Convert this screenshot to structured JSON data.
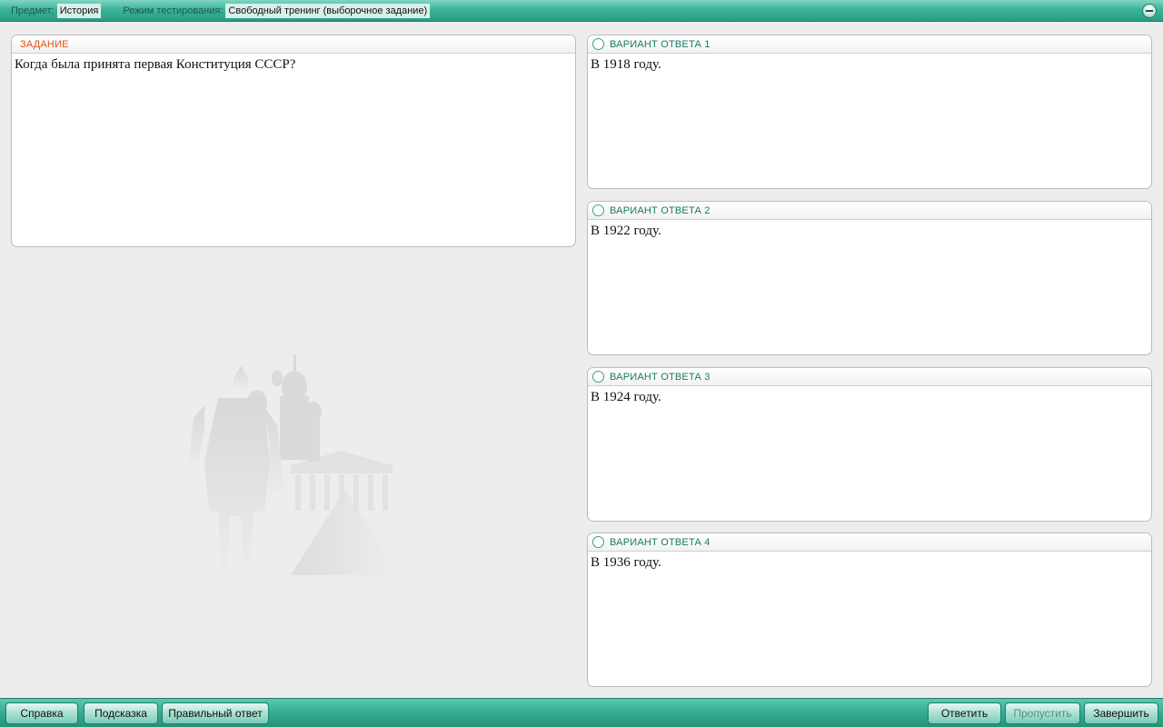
{
  "header": {
    "subject_label": "Предмет:",
    "subject_value": "История",
    "mode_label": "Режим тестирования:",
    "mode_value": "Свободный тренинг (выборочное задание)",
    "minimize_icon": "minus-icon"
  },
  "task": {
    "heading": "ЗАДАНИЕ",
    "text": "Когда была принята первая Конституция СССР?"
  },
  "answers": [
    {
      "heading": "ВАРИАНТ ОТВЕТА 1",
      "text": "В 1918 году.",
      "selected": false
    },
    {
      "heading": "ВАРИАНТ ОТВЕТА 2",
      "text": "В 1922 году.",
      "selected": false
    },
    {
      "heading": "ВАРИАНТ ОТВЕТА 3",
      "text": "В 1924 году.",
      "selected": false
    },
    {
      "heading": "ВАРИАНТ ОТВЕТА 4",
      "text": "В 1936 году.",
      "selected": false
    }
  ],
  "footer": {
    "help": "Справка",
    "hint": "Подсказка",
    "correct_answer": "Правильный ответ",
    "answer": "Ответить",
    "skip": "Пропустить",
    "finish": "Завершить"
  },
  "colors": {
    "accent": "#3cb49a",
    "task_heading": "#e2541a",
    "answer_heading": "#1a7a66"
  }
}
